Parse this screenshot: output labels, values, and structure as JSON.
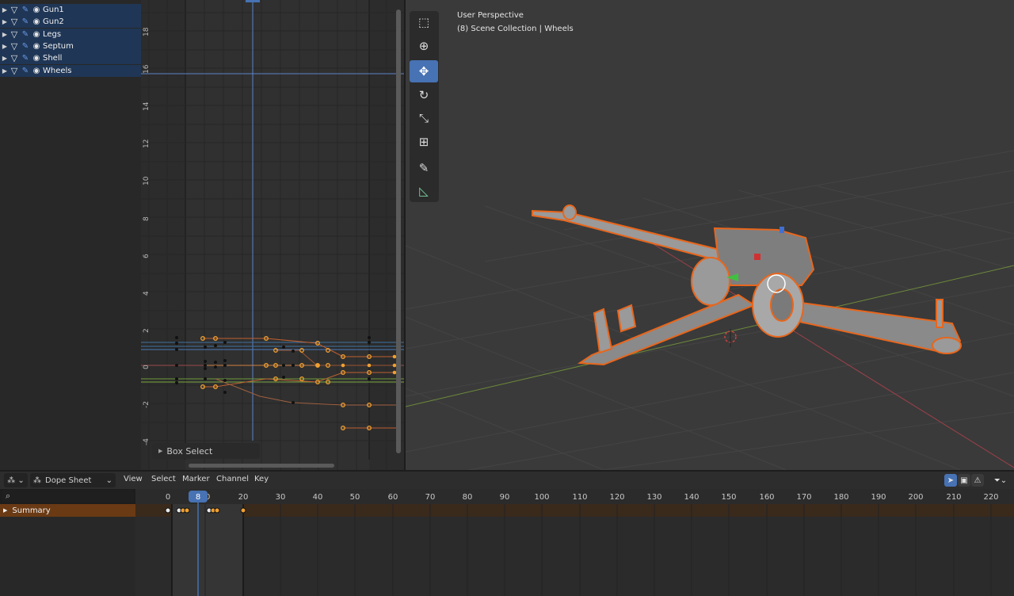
{
  "outliner": {
    "items": [
      {
        "label": "Gun1"
      },
      {
        "label": "Gun2"
      },
      {
        "label": "Legs"
      },
      {
        "label": "Septum"
      },
      {
        "label": "Shell"
      },
      {
        "label": "Wheels"
      }
    ]
  },
  "graph_editor": {
    "y_ticks": [
      "18",
      "16",
      "14",
      "12",
      "10",
      "8",
      "6",
      "4",
      "2",
      "0",
      "-2",
      "-4"
    ],
    "box_select_label": "Box Select"
  },
  "viewport": {
    "title": "User Perspective",
    "subtitle": "(8) Scene Collection | Wheels",
    "tools": [
      {
        "icon": "select-box-icon",
        "active": false
      },
      {
        "icon": "cursor-icon",
        "active": false
      },
      {
        "icon": "move-icon",
        "active": true
      },
      {
        "icon": "rotate-icon",
        "active": false
      },
      {
        "icon": "scale-icon",
        "active": false
      },
      {
        "icon": "transform-icon",
        "active": false
      },
      {
        "icon": "annotate-icon",
        "active": false
      },
      {
        "icon": "measure-icon",
        "active": false
      }
    ]
  },
  "dope_sheet": {
    "editor_type": "Dope Sheet",
    "menus": [
      "View",
      "Select",
      "Marker",
      "Channel",
      "Key"
    ],
    "summary_label": "Summary",
    "current_frame": "8",
    "frame_ticks": [
      "0",
      "10",
      "20",
      "30",
      "40",
      "50",
      "60",
      "70",
      "80",
      "90",
      "100",
      "110",
      "120",
      "130",
      "140",
      "150",
      "160",
      "170",
      "180",
      "190",
      "200",
      "210",
      "220"
    ],
    "colors": {
      "accent": "#4772b3",
      "keyframe": "#f0a030",
      "summary_row": "#6a3a14"
    }
  }
}
